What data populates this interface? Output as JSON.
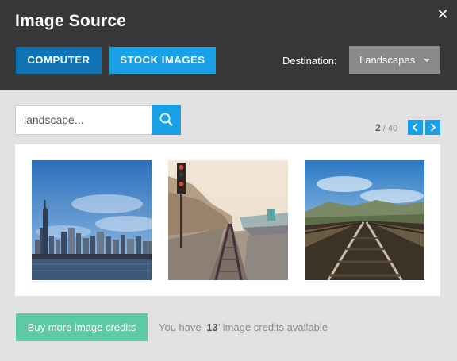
{
  "dialog": {
    "title": "Image Source"
  },
  "tabs": {
    "computer": "COMPUTER",
    "stock": "STOCK IMAGES"
  },
  "destination": {
    "label": "Destination:",
    "selected": "Landscapes"
  },
  "search": {
    "value": "landscape..."
  },
  "pager": {
    "current": "2",
    "separator": "/",
    "total": "40"
  },
  "gallery": {
    "images": [
      "city-skyline-photo",
      "railway-tracks-coast-photo",
      "railway-tracks-bridge-photo"
    ]
  },
  "footer": {
    "buy_label": "Buy more image credits",
    "credits_prefix": "You have ‘",
    "credits_count": "13",
    "credits_suffix": "’ image credits available"
  },
  "colors": {
    "header_bg": "#373737",
    "primary_dark": "#0f72b2",
    "primary": "#1aa0e6",
    "dropdown_bg": "#8a8a8a",
    "success": "#5dcaa6",
    "body_bg": "#e2e2e2"
  },
  "icons": {
    "close": "close-icon",
    "search": "search-icon",
    "prev": "chevron-left-icon",
    "next": "chevron-right-icon",
    "dropdown": "caret-down-icon"
  }
}
